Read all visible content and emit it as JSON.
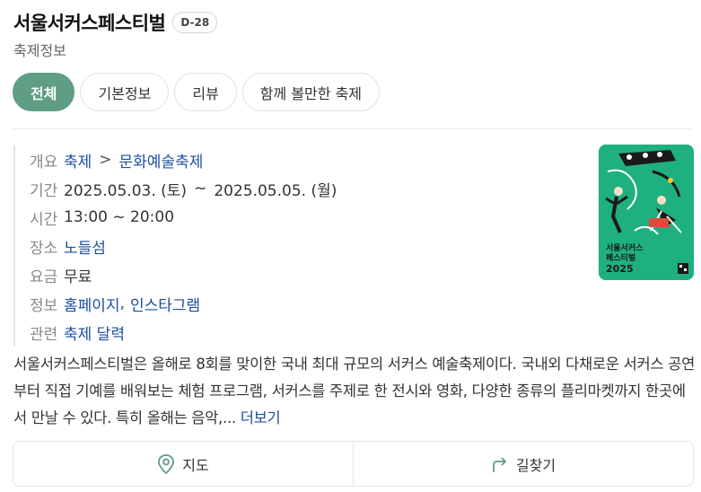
{
  "header": {
    "title": "서울서커스페스티벌",
    "dday": "D-28",
    "category": "축제정보"
  },
  "tabs": [
    {
      "label": "전체",
      "active": true
    },
    {
      "label": "기본정보",
      "active": false
    },
    {
      "label": "리뷰",
      "active": false
    },
    {
      "label": "함께 볼만한 축제",
      "active": false
    }
  ],
  "info": {
    "overview": {
      "label": "개요",
      "category": "축제",
      "subcategory": "문화예술축제"
    },
    "period": {
      "label": "기간",
      "start": "2025.05.03. (토)",
      "tilde": "~",
      "end": "2025.05.05. (월)"
    },
    "time": {
      "label": "시간",
      "value": "13:00 ~ 20:00"
    },
    "place": {
      "label": "장소",
      "value": "노들섬"
    },
    "fee": {
      "label": "요금",
      "value": "무료"
    },
    "links": {
      "label": "정보",
      "homepage": "홈페이지",
      "comma": ",",
      "instagram": "인스타그램"
    },
    "related": {
      "label": "관련",
      "value": "축제 달력"
    }
  },
  "poster": {
    "line1": "서울서커스",
    "line2": "페스티벌",
    "year": "2025",
    "bg": "#1fb07f"
  },
  "description": {
    "text": "서울서커스페스티벌은 올해로 8회를 맞이한 국내 최대 규모의 서커스 예술축제이다. 국내외 다채로운 서커스 공연부터 직접 기예를 배워보는 체험 프로그램, 서커스를 주제로 한 전시와 영화, 다양한 종류의 플리마켓까지 한곳에서 만날 수 있다. 특히 올해는 음악,...",
    "more": "더보기"
  },
  "actions": {
    "map": "지도",
    "directions": "길찾기"
  },
  "colors": {
    "accent": "#5f9d84",
    "link": "#1c4fa0"
  }
}
